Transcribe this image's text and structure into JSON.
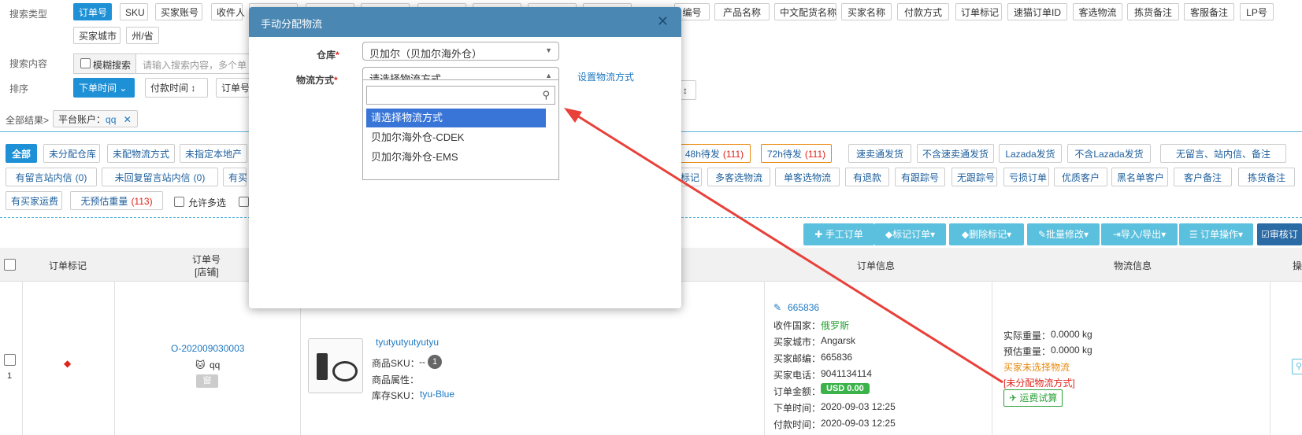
{
  "search": {
    "type_label": "搜索类型",
    "types_row1": [
      "订单号",
      "SKU",
      "买家账号",
      "收件人",
      "",
      "",
      "",
      "",
      "",
      "",
      "",
      "编号",
      "产品名称",
      "中文配货名称",
      "买家名称",
      "付款方式",
      "订单标记",
      "速猫订单ID",
      "客选物流",
      "拣货备注",
      "客服备注",
      "LP号"
    ],
    "types_row2": [
      "买家城市",
      "州/省"
    ],
    "content_label": "搜索内容",
    "fuzzy_label": "模糊搜索",
    "content_placeholder": "请输入搜索内容，多个单",
    "sort_label": "排序",
    "sort_active": "下单时间",
    "sort_pay": "付款时间",
    "sort_order": "订单号",
    "sort_arrow": "↕",
    "result_label": "全部结果>",
    "filter_tag": "平台账户：",
    "filter_value": "qq",
    "filter_close": "✕"
  },
  "filters": {
    "row1": [
      {
        "label": "全部",
        "active": true
      },
      {
        "label": "未分配仓库"
      },
      {
        "label": "未配物流方式"
      },
      {
        "label": "未指定本地产"
      },
      {
        "label": "48h待发",
        "count": "(111)",
        "orange": true
      },
      {
        "label": "72h待发",
        "count": "(111)",
        "orange": true
      },
      {
        "label": "速卖通发货"
      },
      {
        "label": "不含速卖通发货"
      },
      {
        "label": "Lazada发货"
      },
      {
        "label": "不含Lazada发货"
      },
      {
        "label": "无留言、站内信、备注"
      }
    ],
    "row2": [
      {
        "label": "有留言站内信",
        "count": "(0)"
      },
      {
        "label": "未回复留言站内信",
        "count": "(0)"
      },
      {
        "label": "有买"
      },
      {
        "label": "标记"
      },
      {
        "label": "多客选物流"
      },
      {
        "label": "单客选物流"
      },
      {
        "label": "有退款"
      },
      {
        "label": "有跟踪号"
      },
      {
        "label": "无跟踪号"
      },
      {
        "label": "亏损订单"
      },
      {
        "label": "优质客户"
      },
      {
        "label": "黑名单客户"
      },
      {
        "label": "客户备注"
      },
      {
        "label": "拣货备注"
      }
    ],
    "row3": [
      {
        "label": "有买家运费"
      },
      {
        "label": "无预估重量",
        "count": "(113)"
      }
    ],
    "allow_multi": "允许多选"
  },
  "toolbar": {
    "manual_order": "手工订单",
    "mark_order": "标记订单",
    "delete_mark": "删除标记",
    "batch_edit": "批量修改",
    "import_export": "导入/导出",
    "order_ops": "订单操作",
    "review": "审核订"
  },
  "table": {
    "col_mark": "订单标记",
    "col_order_no": "订单号",
    "col_order_shop": "[店铺]",
    "col_order_info": "订单信息",
    "col_logistics": "物流信息",
    "col_ops": "操",
    "row": {
      "index": "1",
      "order_no": "O-202009030003",
      "shop": "qq",
      "badge": "窗",
      "product_name": "tyutyutyutyutyu",
      "sku_label": "商品SKU：",
      "sku_value": "--",
      "qty": "1",
      "attr_label": "商品属性：",
      "stock_sku_label": "库存SKU：",
      "stock_sku_value": "tyu-Blue",
      "order_id": "665836",
      "country_label": "收件国家：",
      "country": "俄罗斯",
      "city_label": "买家城市：",
      "city": "Angarsk",
      "zip_label": "买家邮编：",
      "zip": "665836",
      "phone_label": "买家电话：",
      "phone": "9041134114",
      "amount_label": "订单金额：",
      "amount": "USD 0.00",
      "order_time_label": "下单时间：",
      "order_time": "2020-09-03 12:25",
      "pay_time_label": "付款时间：",
      "pay_time": "2020-09-03 12:25",
      "actual_weight_label": "实际重量：",
      "actual_weight": "0.0000 kg",
      "est_weight_label": "预估重量：",
      "est_weight": "0.0000 kg",
      "no_logistics": "买家未选择物流",
      "unassigned": "[未分配物流方式]",
      "freight_trial": "运费试算"
    }
  },
  "modal": {
    "title": "手动分配物流",
    "close": "✕",
    "warehouse_label": "仓库",
    "warehouse_value": "贝加尔（贝加尔海外仓）",
    "logistics_label": "物流方式",
    "logistics_value": "请选择物流方式",
    "set_logistics": "设置物流方式",
    "required": "*",
    "options": [
      "请选择物流方式",
      "贝加尔海外仓-CDEK",
      "贝加尔海外仓-EMS"
    ]
  }
}
